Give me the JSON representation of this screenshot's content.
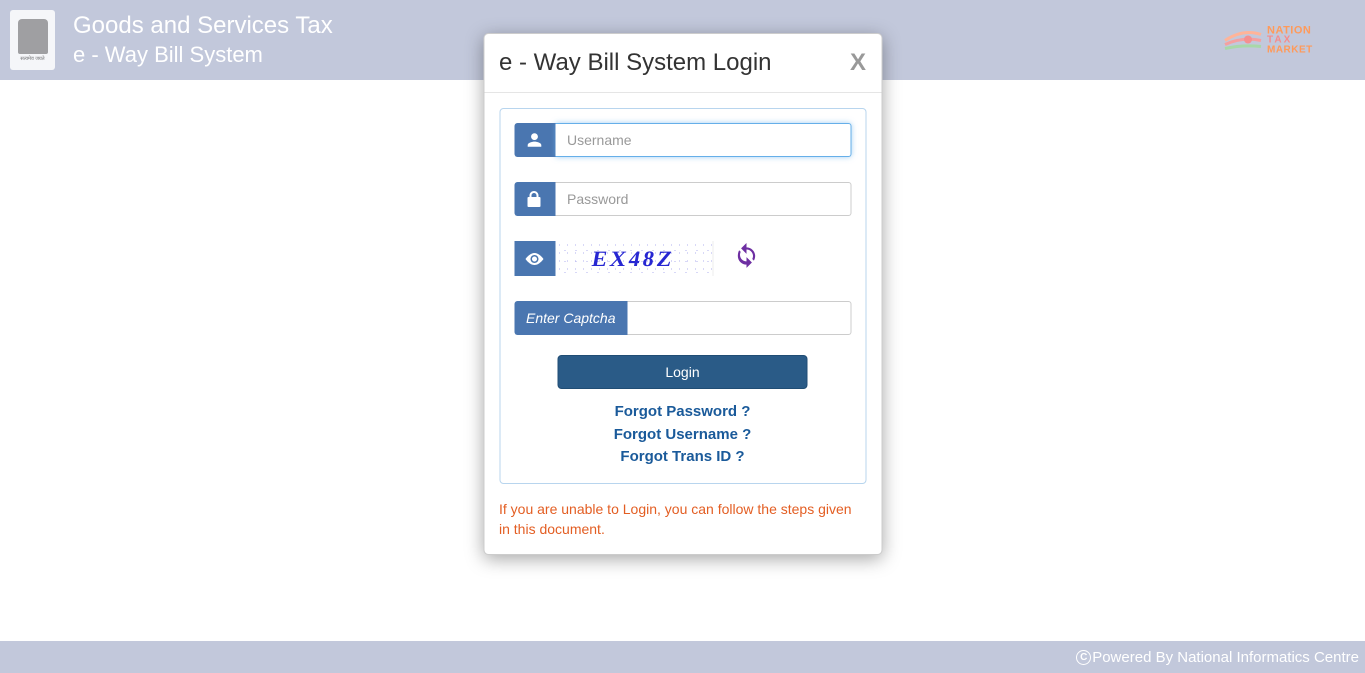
{
  "header": {
    "title1": "Goods and Services Tax",
    "title2": "e - Way Bill System",
    "nation_logo": {
      "line1": "NATION",
      "line2": "TAX",
      "line3": "MARKET"
    }
  },
  "modal": {
    "title": "e - Way Bill System Login",
    "close": "X",
    "username_placeholder": "Username",
    "password_placeholder": "Password",
    "captcha_value": "EX48Z",
    "captcha_label": "Enter Captcha",
    "login_button": "Login",
    "links": {
      "forgot_password": "Forgot Password ?",
      "forgot_username": "Forgot Username ?",
      "forgot_trans": "Forgot Trans ID ?"
    },
    "help_text": "If you are unable to Login, you can follow the steps given in this document."
  },
  "footer": {
    "text": "Powered By National Informatics Centre",
    "icon_char": "C"
  }
}
